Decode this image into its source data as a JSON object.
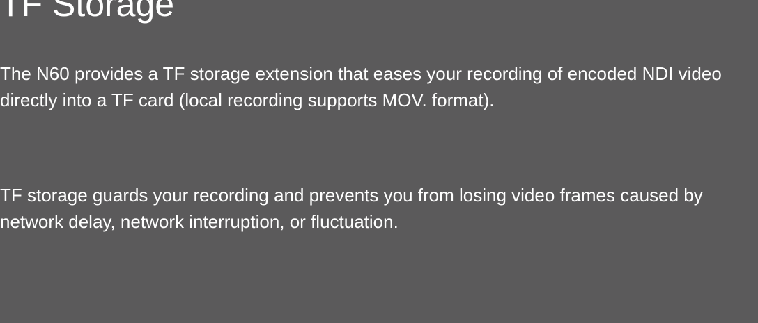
{
  "page": {
    "title": "TF Storage",
    "paragraphs": [
      "The N60 provides a TF storage extension that eases your recording of encoded NDI video directly into a TF card (local recording supports MOV. format).",
      "TF storage guards your recording and prevents you from losing video frames caused by network delay, network interruption, or fluctuation."
    ]
  },
  "colors": {
    "background": "#5b5a5b",
    "text": "#ffffff"
  }
}
